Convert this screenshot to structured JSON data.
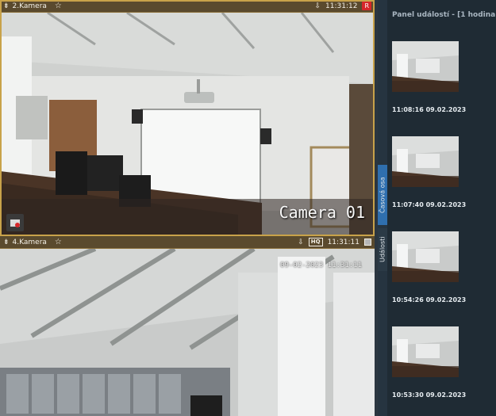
{
  "camera_top": {
    "name": "2.Kamera",
    "time": "11:31:12",
    "rec_badge": "R",
    "overlay_label": "Camera 01"
  },
  "camera_bottom": {
    "name": "4.Kamera",
    "hq_badge": "HQ",
    "time": "11:31:11",
    "overlay_timestamp": "09-02-2023 11:31:11"
  },
  "side_tabs": {
    "casova_osa": "Časová osa",
    "udalosti": "Události"
  },
  "panel": {
    "title": "Panel událostí - [1 hodina",
    "events": [
      {
        "timestamp": "11:08:16 09.02.2023"
      },
      {
        "timestamp": "11:07:40 09.02.2023"
      },
      {
        "timestamp": "10:54:26 09.02.2023"
      },
      {
        "timestamp": "10:53:30 09.02.2023"
      }
    ]
  },
  "icons": {
    "camera_header": "pin-icon",
    "favorite": "star-icon",
    "download": "download-icon",
    "corner": "snapshot-icon"
  },
  "colors": {
    "frame_accent": "#c8a24a",
    "rec": "#d6262a",
    "tab_active": "#2f6fae",
    "panel_bg": "#1f2b34"
  }
}
